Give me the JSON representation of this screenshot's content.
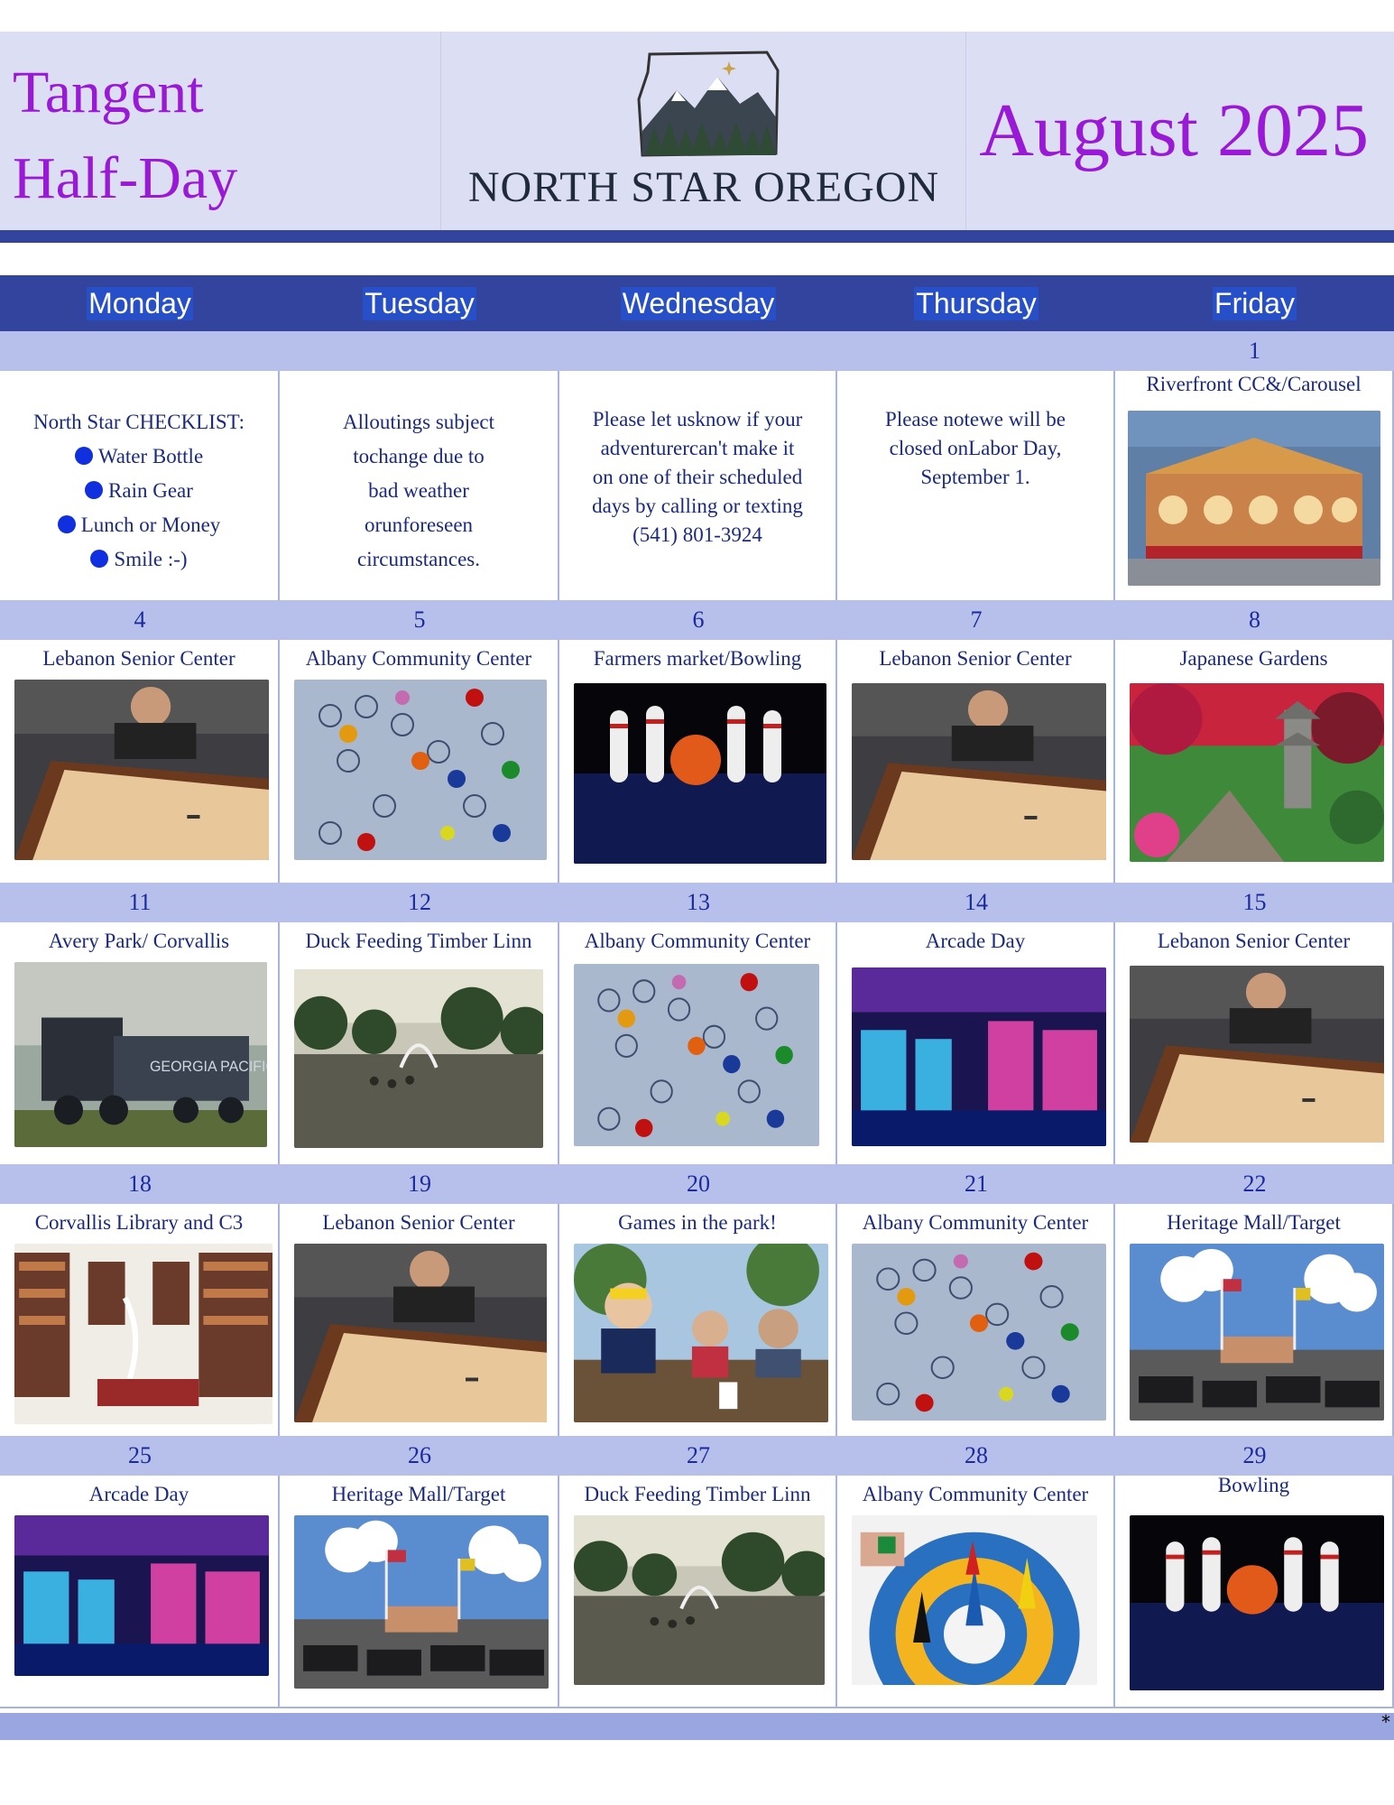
{
  "header": {
    "title_line1": "Tangent",
    "title_line2": "Half-Day",
    "brand": "NORTH STAR OREGON",
    "month": "August 2025"
  },
  "days": [
    "Monday",
    "Tuesday",
    "Wednesday",
    "Thursday",
    "Friday"
  ],
  "week0": {
    "numbers": [
      "",
      "",
      "",
      "",
      "1"
    ],
    "checklist": {
      "heading": "North Star CHECKLIST:",
      "items": [
        "Water Bottle",
        "Rain Gear",
        "Lunch or Money",
        "Smile :-)"
      ]
    },
    "notes": {
      "tue": [
        "Alloutings subject",
        "tochange due to",
        "bad weather",
        "orunforeseen",
        "circumstances."
      ],
      "wed": [
        "Please let usknow if your",
        "adventurercan't make it",
        "on one of their scheduled",
        "days by calling or texting",
        "(541) 801-3924"
      ],
      "thu": [
        "Please notewe will be",
        "closed onLabor Day,",
        "September 1."
      ]
    },
    "fri_title": "Riverfront CC&/Carousel"
  },
  "weeks": [
    {
      "numbers": [
        "4",
        "5",
        "6",
        "7",
        "8"
      ],
      "titles": [
        "Lebanon Senior Center",
        "Albany Community Center",
        "Farmers market/Bowling",
        "Lebanon Senior Center",
        "Japanese Gardens"
      ],
      "photos": [
        "shuffleboard",
        "board-game",
        "bowling",
        "shuffleboard",
        "garden"
      ]
    },
    {
      "numbers": [
        "11",
        "12",
        "13",
        "14",
        "15"
      ],
      "titles": [
        "Avery Park/ Corvallis",
        "Duck Feeding Timber Linn",
        "Albany Community Center",
        "Arcade Day",
        "Lebanon Senior Center"
      ],
      "photos": [
        "train",
        "pond",
        "board-game",
        "arcade",
        "shuffleboard"
      ]
    },
    {
      "numbers": [
        "18",
        "19",
        "20",
        "21",
        "22"
      ],
      "titles": [
        "Corvallis Library and C3",
        "Lebanon Senior Center",
        "Games in the park!",
        "Albany Community Center",
        "Heritage Mall/Target"
      ],
      "photos": [
        "library",
        "shuffleboard",
        "park-group",
        "board-game",
        "mall"
      ]
    },
    {
      "numbers": [
        "25",
        "26",
        "27",
        "28",
        "29"
      ],
      "titles": [
        "Arcade Day",
        "Heritage Mall/Target",
        "Duck Feeding Timber Linn",
        "Albany Community Center",
        "Bowling"
      ],
      "photos": [
        "arcade",
        "mall",
        "pond",
        "ludo",
        "bowling"
      ]
    }
  ],
  "footer_mark": "*"
}
